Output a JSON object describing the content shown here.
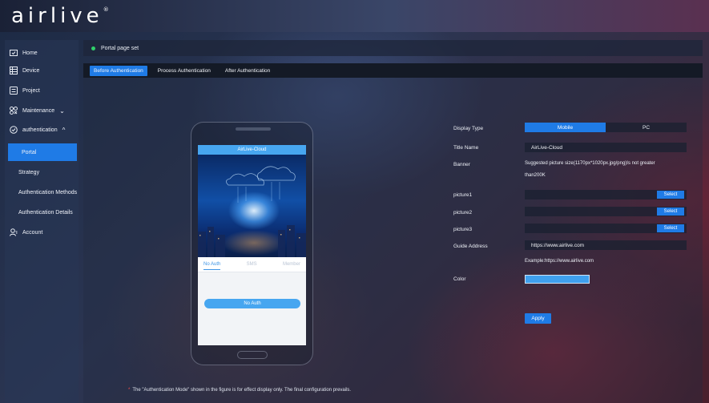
{
  "header": {
    "logo_text": "airlive",
    "logo_mark": "®"
  },
  "sidebar": {
    "items": [
      {
        "label": "Home",
        "icon": "home-icon"
      },
      {
        "label": "Device",
        "icon": "device-icon"
      },
      {
        "label": "Project",
        "icon": "project-icon"
      },
      {
        "label": "Maintenance",
        "icon": "maintenance-icon",
        "chevron": "⌄"
      },
      {
        "label": "authentication",
        "icon": "shield-icon",
        "chevron": "^"
      },
      {
        "label": "Portal"
      },
      {
        "label": "Strategy"
      },
      {
        "label": "Authentication Methods"
      },
      {
        "label": "Authentication Details"
      },
      {
        "label": "Account",
        "icon": "account-icon"
      }
    ],
    "active": "Portal"
  },
  "page": {
    "title": "Portal page set"
  },
  "tabs": [
    {
      "label": "Before Authentication",
      "active": true
    },
    {
      "label": "Process Authentication",
      "active": false
    },
    {
      "label": "After Authentication",
      "active": false
    }
  ],
  "preview": {
    "title": "AirLive-Cloud",
    "tabs": [
      "No Auth",
      "SMS",
      "Member"
    ],
    "button": "No Auth"
  },
  "note": {
    "star": "*",
    "text": "The \"Authentication Mode\" shown in the figure is for effect display only. The final configuration prevails."
  },
  "form": {
    "display_type": {
      "label": "Display Type",
      "options": [
        "Mobile",
        "PC"
      ],
      "selected": "Mobile"
    },
    "title_name": {
      "label": "Title Name",
      "value": "AirLive-Cloud"
    },
    "banner": {
      "label": "Banner",
      "hint_line1": "Suggested picture size(1170px*1020px.jpg/png)Is not greater",
      "hint_line2": "than200K"
    },
    "picture1": {
      "label": "picture1",
      "value": "",
      "button": "Select"
    },
    "picture2": {
      "label": "picture2",
      "value": "",
      "button": "Select"
    },
    "picture3": {
      "label": "picture3",
      "value": "",
      "button": "Select"
    },
    "guide_address": {
      "label": "Guide Address",
      "value": "https://www.airlive.com",
      "example": "Example:https://www.airlive.com"
    },
    "color": {
      "label": "Color",
      "value": "#3fa0ee"
    },
    "apply_button": "Apply"
  },
  "colors": {
    "accent": "#1f7be6",
    "status_dot": "#2fd06a",
    "preview_blue": "#47a6f0"
  }
}
